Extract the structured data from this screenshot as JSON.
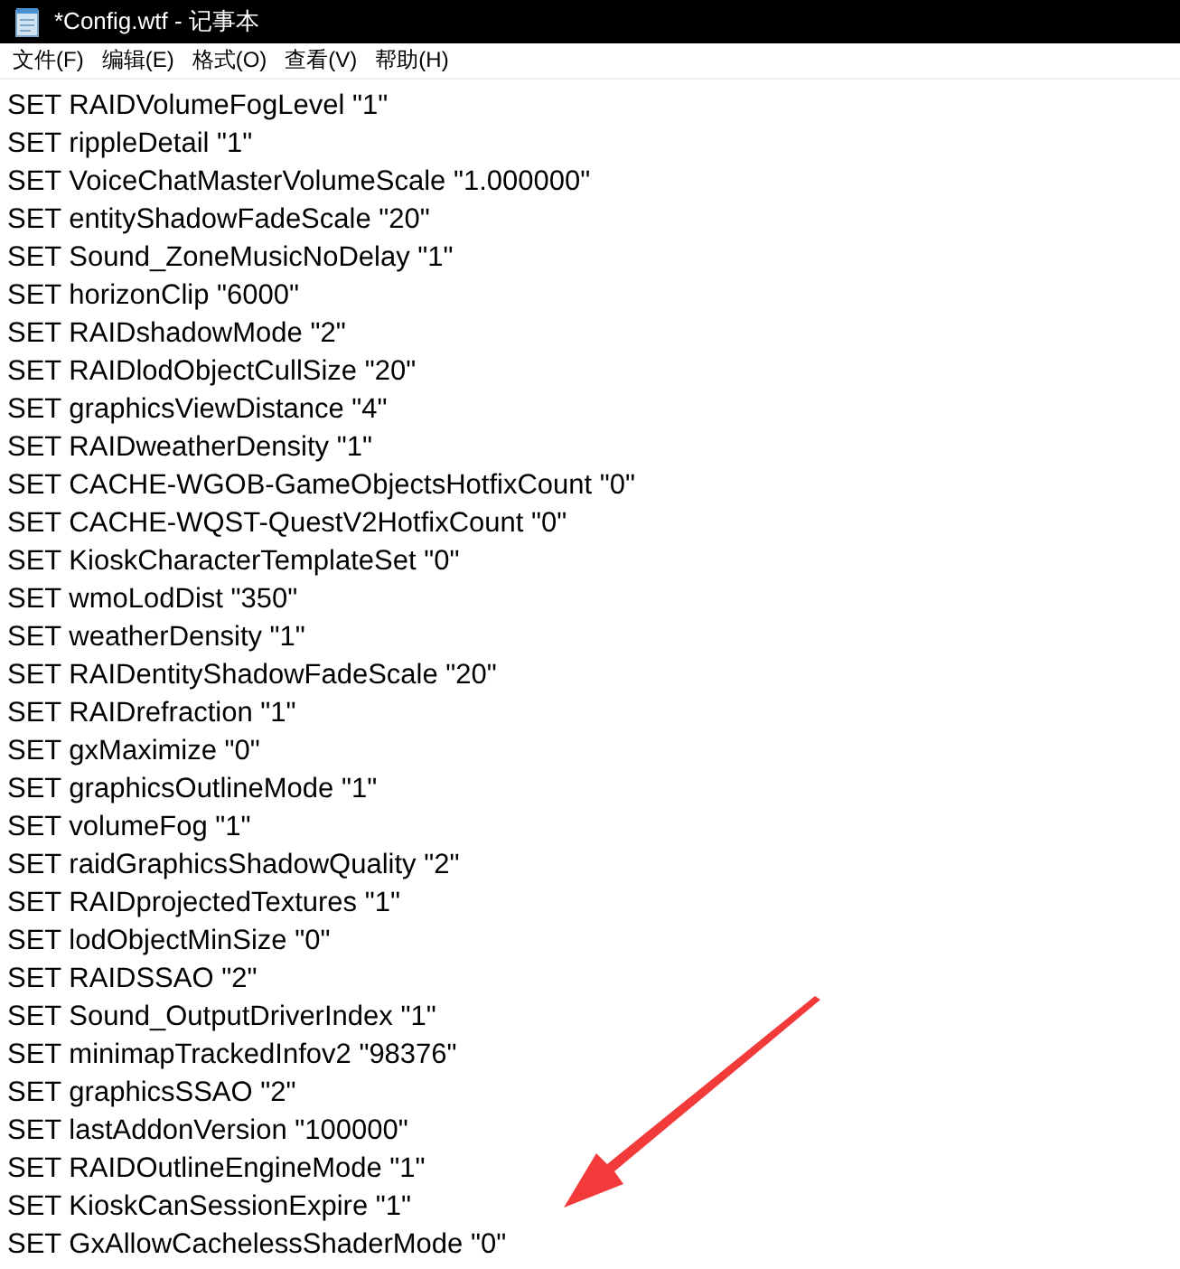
{
  "window": {
    "title": "*Config.wtf - 记事本"
  },
  "menu": [
    "文件(F)",
    "编辑(E)",
    "格式(O)",
    "查看(V)",
    "帮助(H)"
  ],
  "lines": [
    "SET RAIDVolumeFogLevel \"1\"",
    "SET rippleDetail \"1\"",
    "SET VoiceChatMasterVolumeScale \"1.000000\"",
    "SET entityShadowFadeScale \"20\"",
    "SET Sound_ZoneMusicNoDelay \"1\"",
    "SET horizonClip \"6000\"",
    "SET RAIDshadowMode \"2\"",
    "SET RAIDlodObjectCullSize \"20\"",
    "SET graphicsViewDistance \"4\"",
    "SET RAIDweatherDensity \"1\"",
    "SET CACHE-WGOB-GameObjectsHotfixCount \"0\"",
    "SET CACHE-WQST-QuestV2HotfixCount \"0\"",
    "SET KioskCharacterTemplateSet \"0\"",
    "SET wmoLodDist \"350\"",
    "SET weatherDensity \"1\"",
    "SET RAIDentityShadowFadeScale \"20\"",
    "SET RAIDrefraction \"1\"",
    "SET gxMaximize \"0\"",
    "SET graphicsOutlineMode \"1\"",
    "SET volumeFog \"1\"",
    "SET raidGraphicsShadowQuality \"2\"",
    "SET RAIDprojectedTextures \"1\"",
    "SET lodObjectMinSize \"0\"",
    "SET RAIDSSAO \"2\"",
    "SET Sound_OutputDriverIndex \"1\"",
    "SET minimapTrackedInfov2 \"98376\"",
    "SET graphicsSSAO \"2\"",
    "SET lastAddonVersion \"100000\"",
    "SET RAIDOutlineEngineMode \"1\"",
    "SET KioskCanSessionExpire \"1\"",
    "SET GxAllowCachelessShaderMode \"0\""
  ]
}
